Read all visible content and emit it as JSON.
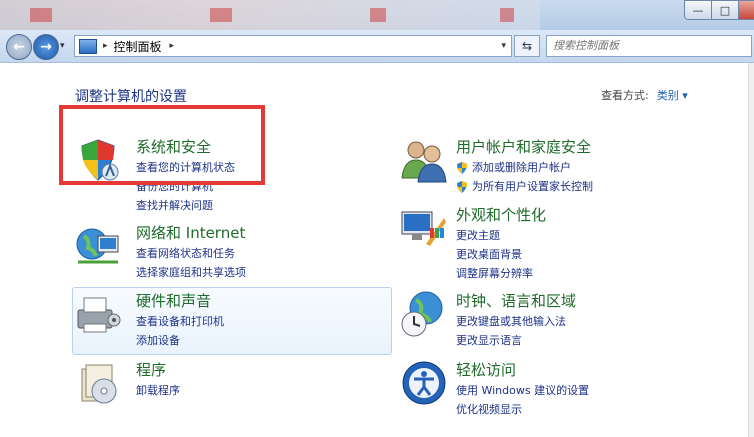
{
  "window": {
    "minimize": "—",
    "maximize": "□"
  },
  "nav": {
    "back": "←",
    "forward": "→"
  },
  "address": {
    "separator": "▸",
    "path": "控制面板",
    "arrow": "▸"
  },
  "search": {
    "placeholder": "搜索控制面板"
  },
  "main": {
    "heading": "调整计算机的设置",
    "view_by_label": "查看方式:",
    "view_by_value": "类别 ▾"
  },
  "categories": [
    {
      "title": "系统和安全",
      "links": [
        "查看您的计算机状态",
        "备份您的计算机",
        "查找并解决问题"
      ],
      "icon": "shield-icon"
    },
    {
      "title": "网络和 Internet",
      "links": [
        "查看网络状态和任务",
        "选择家庭组和共享选项"
      ],
      "icon": "network-globe-icon"
    },
    {
      "title": "硬件和声音",
      "links": [
        "查看设备和打印机",
        "添加设备"
      ],
      "icon": "printer-icon"
    },
    {
      "title": "程序",
      "links": [
        "卸载程序"
      ],
      "icon": "programs-disc-icon"
    },
    {
      "title": "用户帐户和家庭安全",
      "links": [
        "添加或删除用户帐户",
        "为所有用户设置家长控制"
      ],
      "icon": "users-icon"
    },
    {
      "title": "外观和个性化",
      "links": [
        "更改主题",
        "更改桌面背景",
        "调整屏幕分辨率"
      ],
      "icon": "monitor-palette-icon"
    },
    {
      "title": "时钟、语言和区域",
      "links": [
        "更改键盘或其他输入法",
        "更改显示语言"
      ],
      "icon": "clock-globe-icon"
    },
    {
      "title": "轻松访问",
      "links": [
        "使用 Windows 建议的设置",
        "优化视频显示"
      ],
      "icon": "ease-of-access-icon"
    }
  ],
  "colors": {
    "category_title": "#1e6b2a",
    "link": "#1e3287",
    "highlight_box": "#e53935"
  }
}
